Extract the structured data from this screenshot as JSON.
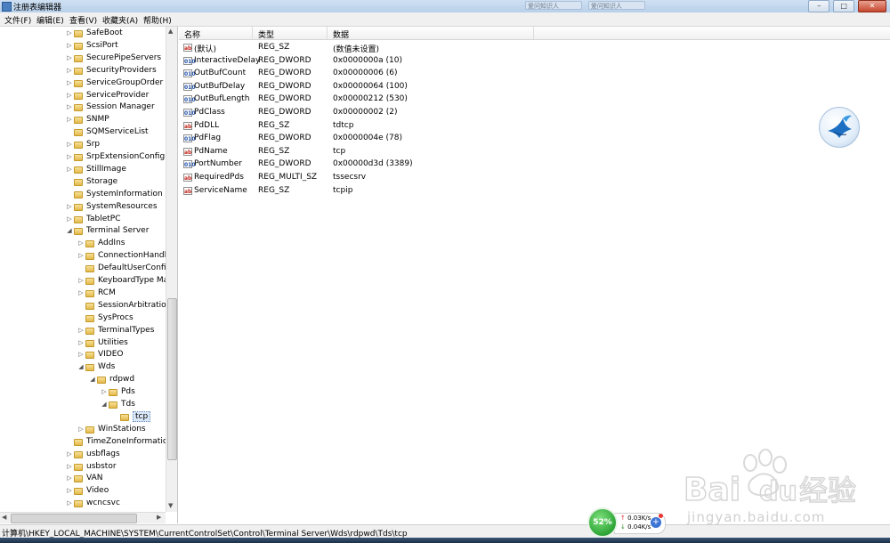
{
  "window": {
    "title": "注册表编辑器",
    "tab_text": "爱问知识人"
  },
  "menu": [
    "文件(F)",
    "编辑(E)",
    "查看(V)",
    "收藏夹(A)",
    "帮助(H)"
  ],
  "tree": [
    {
      "label": "SafeBoot",
      "depth": 0,
      "exp": "▷"
    },
    {
      "label": "ScsiPort",
      "depth": 0,
      "exp": "▷"
    },
    {
      "label": "SecurePipeServers",
      "depth": 0,
      "exp": "▷"
    },
    {
      "label": "SecurityProviders",
      "depth": 0,
      "exp": "▷"
    },
    {
      "label": "ServiceGroupOrder",
      "depth": 0,
      "exp": "▷"
    },
    {
      "label": "ServiceProvider",
      "depth": 0,
      "exp": "▷"
    },
    {
      "label": "Session Manager",
      "depth": 0,
      "exp": "▷"
    },
    {
      "label": "SNMP",
      "depth": 0,
      "exp": "▷"
    },
    {
      "label": "SQMServiceList",
      "depth": 0,
      "exp": ""
    },
    {
      "label": "Srp",
      "depth": 0,
      "exp": "▷"
    },
    {
      "label": "SrpExtensionConfig",
      "depth": 0,
      "exp": "▷"
    },
    {
      "label": "StillImage",
      "depth": 0,
      "exp": "▷"
    },
    {
      "label": "Storage",
      "depth": 0,
      "exp": ""
    },
    {
      "label": "SystemInformation",
      "depth": 0,
      "exp": ""
    },
    {
      "label": "SystemResources",
      "depth": 0,
      "exp": "▷"
    },
    {
      "label": "TabletPC",
      "depth": 0,
      "exp": "▷"
    },
    {
      "label": "Terminal Server",
      "depth": 0,
      "exp": "◢"
    },
    {
      "label": "AddIns",
      "depth": 1,
      "exp": "▷"
    },
    {
      "label": "ConnectionHandler",
      "depth": 1,
      "exp": "▷"
    },
    {
      "label": "DefaultUserConfigu",
      "depth": 1,
      "exp": ""
    },
    {
      "label": "KeyboardType Map",
      "depth": 1,
      "exp": "▷"
    },
    {
      "label": "RCM",
      "depth": 1,
      "exp": "▷"
    },
    {
      "label": "SessionArbitrationH",
      "depth": 1,
      "exp": ""
    },
    {
      "label": "SysProcs",
      "depth": 1,
      "exp": ""
    },
    {
      "label": "TerminalTypes",
      "depth": 1,
      "exp": "▷"
    },
    {
      "label": "Utilities",
      "depth": 1,
      "exp": "▷"
    },
    {
      "label": "VIDEO",
      "depth": 1,
      "exp": "▷"
    },
    {
      "label": "Wds",
      "depth": 1,
      "exp": "◢"
    },
    {
      "label": "rdpwd",
      "depth": 2,
      "exp": "◢"
    },
    {
      "label": "Pds",
      "depth": 3,
      "exp": "▷"
    },
    {
      "label": "Tds",
      "depth": 3,
      "exp": "◢"
    },
    {
      "label": "tcp",
      "depth": 4,
      "exp": "",
      "selected": true
    },
    {
      "label": "WinStations",
      "depth": 1,
      "exp": "▷"
    },
    {
      "label": "TimeZoneInformation",
      "depth": 0,
      "exp": ""
    },
    {
      "label": "usbflags",
      "depth": 0,
      "exp": "▷"
    },
    {
      "label": "usbstor",
      "depth": 0,
      "exp": "▷"
    },
    {
      "label": "VAN",
      "depth": 0,
      "exp": "▷"
    },
    {
      "label": "Video",
      "depth": 0,
      "exp": "▷"
    },
    {
      "label": "wcncsvc",
      "depth": 0,
      "exp": "▷"
    }
  ],
  "list": {
    "columns": [
      "名称",
      "类型",
      "数据"
    ],
    "rows": [
      {
        "name": "(默认)",
        "type": "REG_SZ",
        "data": "(数值未设置)",
        "icon": "ab"
      },
      {
        "name": "InteractiveDelay",
        "type": "REG_DWORD",
        "data": "0x0000000a (10)",
        "icon": "010"
      },
      {
        "name": "OutBufCount",
        "type": "REG_DWORD",
        "data": "0x00000006 (6)",
        "icon": "010"
      },
      {
        "name": "OutBufDelay",
        "type": "REG_DWORD",
        "data": "0x00000064 (100)",
        "icon": "010"
      },
      {
        "name": "OutBufLength",
        "type": "REG_DWORD",
        "data": "0x00000212 (530)",
        "icon": "010"
      },
      {
        "name": "PdClass",
        "type": "REG_DWORD",
        "data": "0x00000002 (2)",
        "icon": "010"
      },
      {
        "name": "PdDLL",
        "type": "REG_SZ",
        "data": "tdtcp",
        "icon": "ab"
      },
      {
        "name": "PdFlag",
        "type": "REG_DWORD",
        "data": "0x0000004e (78)",
        "icon": "010"
      },
      {
        "name": "PdName",
        "type": "REG_SZ",
        "data": "tcp",
        "icon": "ab"
      },
      {
        "name": "PortNumber",
        "type": "REG_DWORD",
        "data": "0x00000d3d (3389)",
        "icon": "010"
      },
      {
        "name": "RequiredPds",
        "type": "REG_MULTI_SZ",
        "data": "tssecsrv",
        "icon": "ab"
      },
      {
        "name": "ServiceName",
        "type": "REG_SZ",
        "data": "tcpip",
        "icon": "ab"
      }
    ]
  },
  "status": "计算机\\HKEY_LOCAL_MACHINE\\SYSTEM\\CurrentControlSet\\Control\\Terminal Server\\Wds\\rdpwd\\Tds\\tcp",
  "speed_widget": {
    "percent": "52%",
    "up": "0.03K/s",
    "down": "0.04K/s"
  },
  "watermark": {
    "brand": "Bai",
    "brand_du": "du",
    "brand_cn": "经验",
    "url": "jingyan.baidu.com"
  },
  "colors": {
    "selection": "#dbe8f8",
    "sz_icon": "#c2281c",
    "dword_icon": "#1f4fa8",
    "speed_green": "#2da536"
  },
  "icons": {
    "value_sz": "ab-string-icon",
    "value_dword": "binary-010-icon",
    "folder": "folder-icon"
  }
}
